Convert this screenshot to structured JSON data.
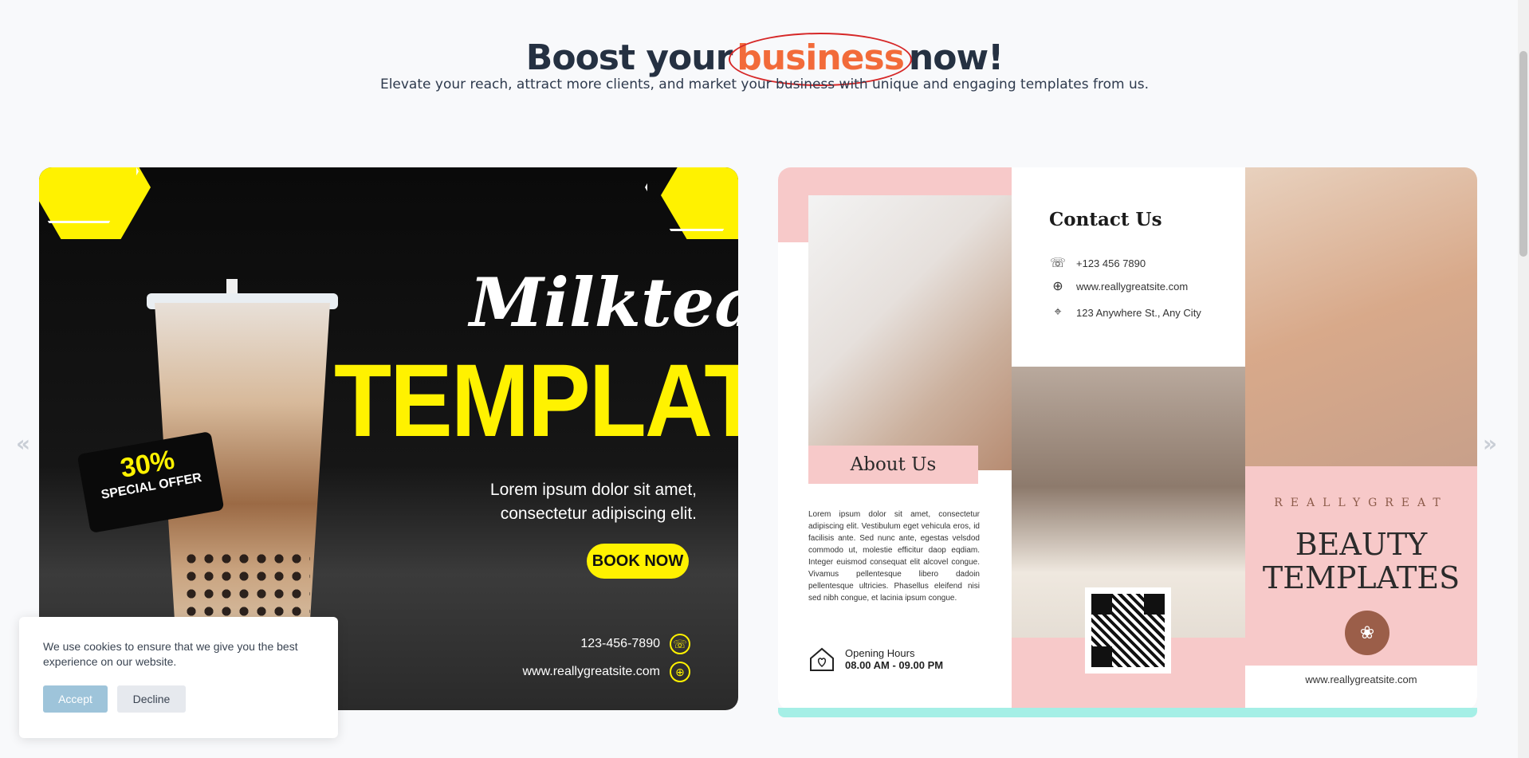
{
  "header": {
    "title_before": "Boost your",
    "title_highlight": "business",
    "title_after": "now!",
    "subtitle": "Elevate your reach, attract more clients, and market your business with unique and engaging templates from us."
  },
  "carousel": {
    "prev_arrow": "«",
    "next_arrow": "»",
    "slide1": {
      "script_title": "Milktea",
      "big_title": "TEMPLATES",
      "offer_percent": "30%",
      "offer_text": "SPECIAL OFFER",
      "lorem_line1": "Lorem ipsum dolor sit amet,",
      "lorem_line2": "consectetur adipiscing elit.",
      "cta": "BOOK NOW",
      "phone": "123-456-7890",
      "website": "www.reallygreatsite.com"
    },
    "slide2": {
      "contact_title": "Contact Us",
      "phone": "+123 456 7890",
      "website": "www.reallygreatsite.com",
      "address": "123 Anywhere St., Any City",
      "about_title": "About Us",
      "about_text": "Lorem ipsum dolor sit amet, consectetur adipiscing elit. Vestibulum eget vehicula eros, id facilisis ante. Sed nunc ante, egestas velsdod commodo ut, molestie efficitur daop eqdiam. Integer euismod consequat elit alcovel congue. Vivamus pellentesque libero dadoin pellentesque ultricies. Phasellus eleifend nisi sed nibh congue, et lacinia ipsum congue.",
      "hours_label": "Opening Hours",
      "hours_value": "08.00 AM - 09.00 PM",
      "brand": "REALLYGREAT",
      "title_line1": "BEAUTY",
      "title_line2": "TEMPLATES",
      "footer_site": "www.reallygreatsite.com"
    }
  },
  "cookie": {
    "message": "We use cookies to ensure that we give you the best experience on our website.",
    "accept_label": "Accept",
    "decline_label": "Decline"
  },
  "colors": {
    "highlight": "#f26b3a",
    "yellow": "#fff200",
    "pink": "#f7c9c9",
    "teal": "#a5efe6"
  }
}
